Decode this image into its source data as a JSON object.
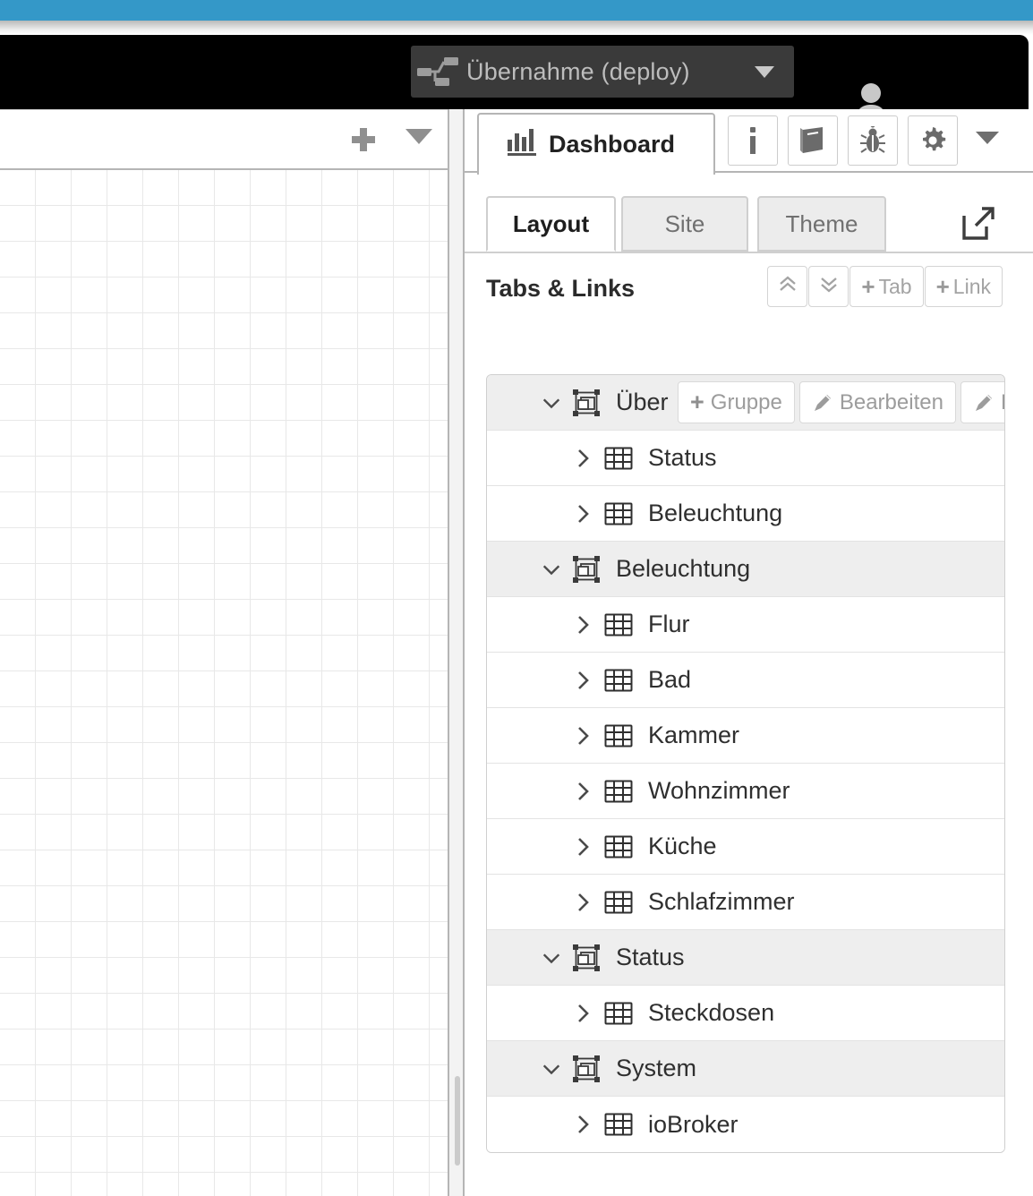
{
  "header": {
    "deploy_label": "Übernahme (deploy)",
    "deploy_icon": "deploy-nodes-icon",
    "deploy_caret_icon": "caret-down-icon",
    "user_icon": "user-account-icon",
    "menu_icon": "hamburger-menu-icon",
    "accent_blue": "#3498c8",
    "header_bg": "#000000",
    "deploy_bg": "#3a3a3a"
  },
  "editor": {
    "add_flow_icon": "plus-icon",
    "flow_menu_icon": "caret-down-icon",
    "canvas_name": "flow-canvas",
    "grid_size": 40
  },
  "splitter": {
    "handle_icon": "drag-handle"
  },
  "sidebar": {
    "tab": {
      "label": "Dashboard",
      "icon": "bar-chart-icon"
    },
    "action_buttons": [
      {
        "name": "info-button",
        "icon": "info-icon"
      },
      {
        "name": "help-book-button",
        "icon": "book-icon"
      },
      {
        "name": "debug-button",
        "icon": "bug-icon"
      },
      {
        "name": "config-button",
        "icon": "gear-icon"
      }
    ],
    "more_icon": "caret-down-icon",
    "subtabs": [
      {
        "label": "Layout",
        "active": true
      },
      {
        "label": "Site",
        "active": false
      },
      {
        "label": "Theme",
        "active": false
      }
    ],
    "open_dashboard_icon": "external-link-icon",
    "section": {
      "title": "Tabs & Links",
      "buttons": [
        {
          "name": "collapse-all-button",
          "label": "",
          "icon": "double-chevron-up-icon"
        },
        {
          "name": "expand-all-button",
          "label": "",
          "icon": "double-chevron-down-icon"
        },
        {
          "name": "add-tab-button",
          "label": "Tab",
          "icon": "plus-icon"
        },
        {
          "name": "add-link-button",
          "label": "Link",
          "icon": "plus-icon"
        }
      ]
    },
    "row_actions": [
      {
        "name": "add-group-button",
        "label": "Gruppe",
        "icon": "plus-icon"
      },
      {
        "name": "edit-tab-button",
        "label": "Bearbeiten",
        "icon": "pencil-icon"
      },
      {
        "name": "layout-tab-button",
        "label": "Layout",
        "icon": "pencil-icon"
      }
    ],
    "tree": [
      {
        "type": "tab",
        "label": "Über",
        "expanded": true,
        "icon": "tab-frame-icon",
        "chevron": "chevron-down-icon",
        "hovered": true
      },
      {
        "type": "group",
        "label": "Status",
        "expanded": false,
        "icon": "group-grid-icon",
        "chevron": "chevron-right-icon",
        "hovered": false
      },
      {
        "type": "group",
        "label": "Beleuchtung",
        "expanded": false,
        "icon": "group-grid-icon",
        "chevron": "chevron-right-icon",
        "hovered": false
      },
      {
        "type": "tab",
        "label": "Beleuchtung",
        "expanded": true,
        "icon": "tab-frame-icon",
        "chevron": "chevron-down-icon",
        "hovered": false
      },
      {
        "type": "group",
        "label": "Flur",
        "expanded": false,
        "icon": "group-grid-icon",
        "chevron": "chevron-right-icon",
        "hovered": false
      },
      {
        "type": "group",
        "label": "Bad",
        "expanded": false,
        "icon": "group-grid-icon",
        "chevron": "chevron-right-icon",
        "hovered": false
      },
      {
        "type": "group",
        "label": "Kammer",
        "expanded": false,
        "icon": "group-grid-icon",
        "chevron": "chevron-right-icon",
        "hovered": false
      },
      {
        "type": "group",
        "label": "Wohnzimmer",
        "expanded": false,
        "icon": "group-grid-icon",
        "chevron": "chevron-right-icon",
        "hovered": false
      },
      {
        "type": "group",
        "label": "Küche",
        "expanded": false,
        "icon": "group-grid-icon",
        "chevron": "chevron-right-icon",
        "hovered": false
      },
      {
        "type": "group",
        "label": "Schlafzimmer",
        "expanded": false,
        "icon": "group-grid-icon",
        "chevron": "chevron-right-icon",
        "hovered": false
      },
      {
        "type": "tab",
        "label": "Status",
        "expanded": true,
        "icon": "tab-frame-icon",
        "chevron": "chevron-down-icon",
        "hovered": false
      },
      {
        "type": "group",
        "label": "Steckdosen",
        "expanded": false,
        "icon": "group-grid-icon",
        "chevron": "chevron-right-icon",
        "hovered": false
      },
      {
        "type": "tab",
        "label": "System",
        "expanded": true,
        "icon": "tab-frame-icon",
        "chevron": "chevron-down-icon",
        "hovered": false
      },
      {
        "type": "group",
        "label": "ioBroker",
        "expanded": false,
        "icon": "group-grid-icon",
        "chevron": "chevron-right-icon",
        "hovered": false
      }
    ]
  }
}
